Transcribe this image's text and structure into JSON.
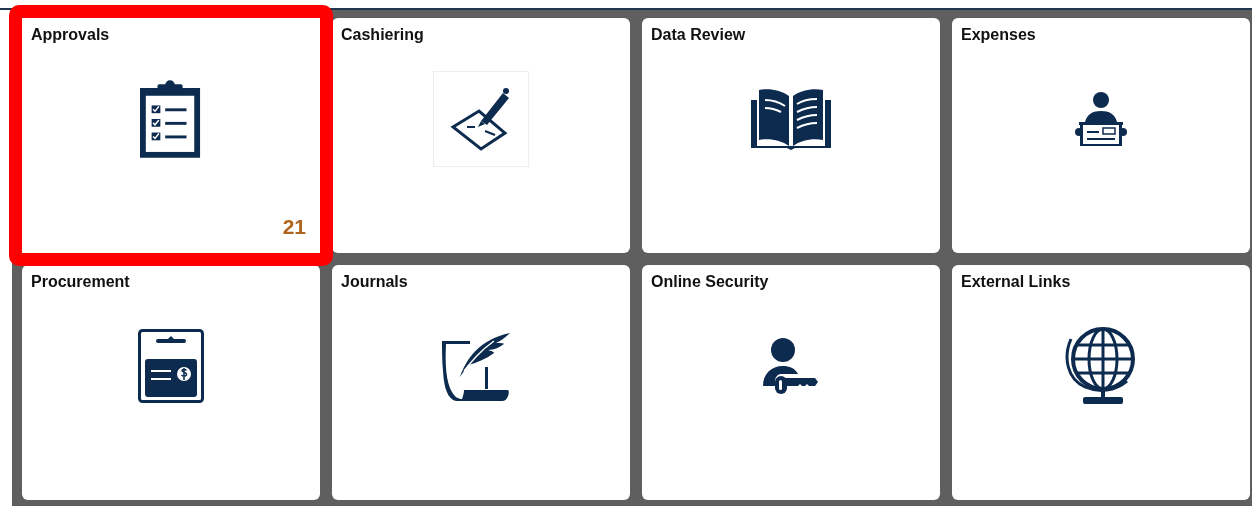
{
  "tiles": [
    {
      "title": "Approvals",
      "highlighted": true,
      "badge": "21"
    },
    {
      "title": "Cashiering",
      "highlighted": false
    },
    {
      "title": "Data Review",
      "highlighted": false
    },
    {
      "title": "Expenses",
      "highlighted": false
    },
    {
      "title": "Procurement",
      "highlighted": false
    },
    {
      "title": "Journals",
      "highlighted": false
    },
    {
      "title": "Online Security",
      "highlighted": false
    },
    {
      "title": "External Links",
      "highlighted": false
    }
  ]
}
